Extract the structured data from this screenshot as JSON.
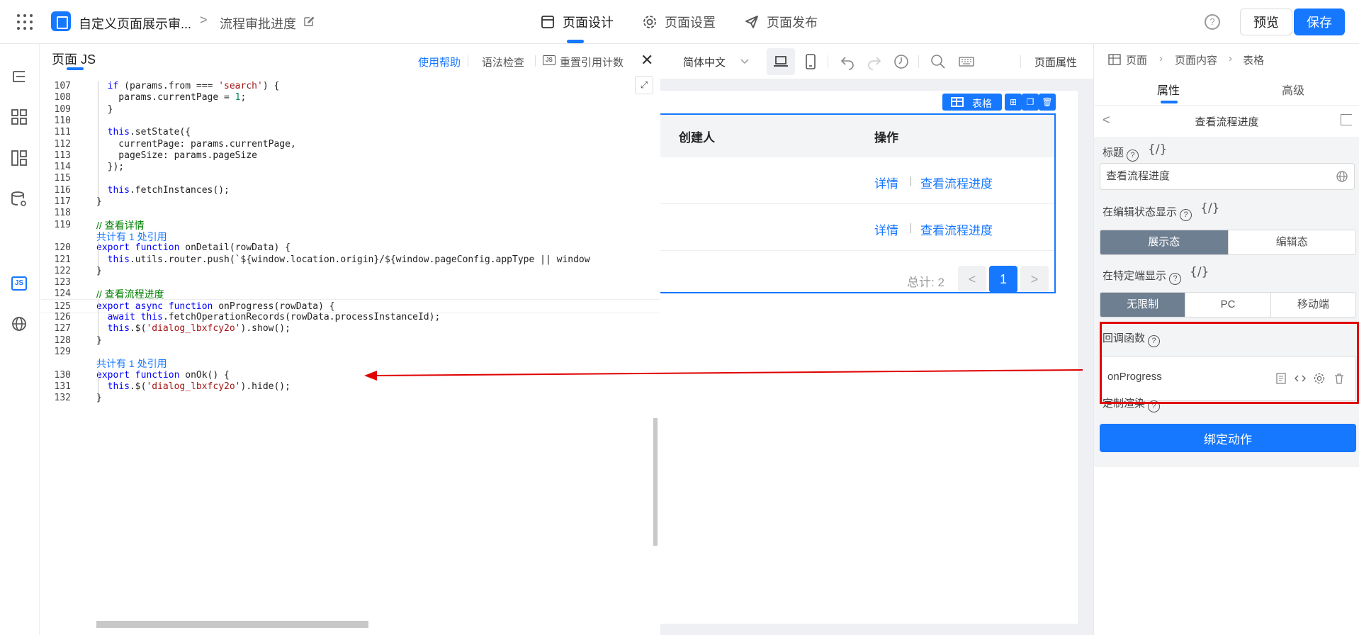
{
  "topbar": {
    "app_title": "自定义页面展示审...",
    "crumb_sep": ">",
    "page_name": "流程审批进度",
    "tabs": [
      "页面设计",
      "页面设置",
      "页面发布"
    ],
    "help_q": "?",
    "preview": "预览",
    "save": "保存",
    "accent": "#1677ff"
  },
  "leftrail": {
    "icons": [
      "outline-icon",
      "components-icon",
      "layout-icon",
      "datasource-icon",
      "js-icon",
      "globe-icon"
    ],
    "js_label": "JS"
  },
  "js_panel": {
    "title": "页面 JS",
    "help": "使用帮助",
    "check": "语法检查",
    "reset": "重置引用计数",
    "reset_icon_text": "JS",
    "close": "✕",
    "expand": "⤢",
    "lines": [
      {
        "n": "107",
        "code": "  if (params.from === 'search') {"
      },
      {
        "n": "108",
        "code": "    params.currentPage = 1;"
      },
      {
        "n": "109",
        "code": "  }"
      },
      {
        "n": "110",
        "code": ""
      },
      {
        "n": "111",
        "code": "  this.setState({"
      },
      {
        "n": "112",
        "code": "    currentPage: params.currentPage,"
      },
      {
        "n": "113",
        "code": "    pageSize: params.pageSize"
      },
      {
        "n": "114",
        "code": "  });"
      },
      {
        "n": "115",
        "code": ""
      },
      {
        "n": "116",
        "code": "  this.fetchInstances();"
      },
      {
        "n": "117",
        "code": "}"
      },
      {
        "n": "118",
        "code": ""
      },
      {
        "n": "119",
        "code": "// 查看详情"
      },
      {
        "ref": "共计有 1 处引用"
      },
      {
        "n": "120",
        "code": "export function onDetail(rowData) {"
      },
      {
        "n": "121",
        "code": "  this.utils.router.push(`${window.location.origin}/${window.pageConfig.appType || window"
      },
      {
        "n": "122",
        "code": "}"
      },
      {
        "n": "123",
        "code": ""
      },
      {
        "n": "124",
        "code": "// 查看流程进度"
      },
      {
        "n": "125",
        "code": "export async function onProgress(rowData) {"
      },
      {
        "n": "126",
        "code": "  await this.fetchOperationRecords(rowData.processInstanceId);"
      },
      {
        "n": "127",
        "code": "  this.$('dialog_lbxfcy2o').show();"
      },
      {
        "n": "128",
        "code": "}"
      },
      {
        "n": "129",
        "code": ""
      },
      {
        "ref": "共计有 1 处引用"
      },
      {
        "n": "130",
        "code": "export function onOk() {"
      },
      {
        "n": "131",
        "code": "  this.$('dialog_lbxfcy2o').hide();"
      },
      {
        "n": "132",
        "code": "}"
      }
    ]
  },
  "canvas": {
    "language": "简体中文",
    "page_props": "页面属性",
    "table_badge": "表格",
    "columns": [
      "创建人",
      "操作"
    ],
    "rows": [
      {
        "detail": "详情",
        "progress": "查看流程进度"
      },
      {
        "detail": "详情",
        "progress": "查看流程进度"
      }
    ],
    "total": "总计: 2",
    "prev": "<",
    "current_page": "1",
    "next": ">"
  },
  "right_panel": {
    "breadcrumb": [
      "页面",
      "页面内容",
      "表格"
    ],
    "tabs": [
      "属性",
      "高级"
    ],
    "subtitle": "查看流程进度",
    "back": "<",
    "title_label": "标题",
    "title_value": "查看流程进度",
    "var_symbol": "{/}",
    "q": "?",
    "edit_state_label": "在编辑状态显示",
    "edit_state_options": [
      "展示态",
      "编辑态"
    ],
    "device_label": "在特定端显示",
    "device_options": [
      "无限制",
      "PC",
      "移动端"
    ],
    "callback_label": "回调函数",
    "callback_value": "onProgress",
    "custom_render_label": "定制渲染",
    "bind_action": "绑定动作",
    "highlight_color": "#e00000"
  }
}
